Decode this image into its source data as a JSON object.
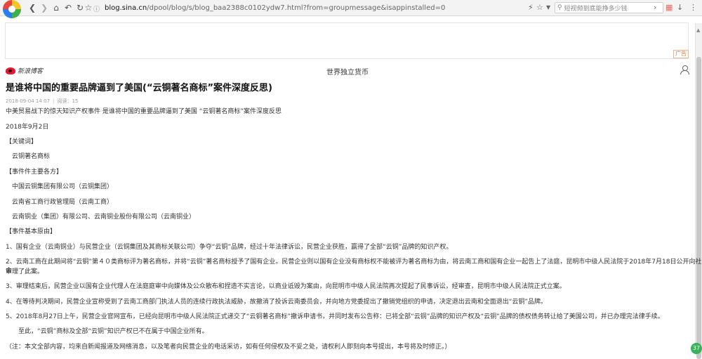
{
  "browser": {
    "url_host": "blog.sina.cn",
    "url_path": "/dpool/blog/s/blog_baa2388c0102ydw7.html?from=groupmessage&isappinstalled=0",
    "search_placeholder": "短视频到底能挣多少钱"
  },
  "ad": {
    "badge": "广告"
  },
  "blog": {
    "logo_text": "新浪博客",
    "blog_name": "世界独立货币"
  },
  "article": {
    "title": "是谁将中国的重要品牌逼到了美国(“云铜著名商标”案件深度反思)",
    "date": "2018-09-04 14:07",
    "reads": "阅读：15",
    "subtitle": "中美贸易战下的惊天知识产权事件 是谁将中国的重要品牌逼到了美国 “云铜著名商标”案件深度反思",
    "pub_date": "2018年9月2日",
    "kw_heading": "【关键词】",
    "kw": "云铜著名商标",
    "parties_heading": "【事件件主要各方】",
    "party1": "中国云铜集团有限公司（云铜集团）",
    "party2": "云南省工商行政管理局（云南工商）",
    "party3": "云南铜业（集团）有限公司、云南铜业股份有限公司（云南铜业）",
    "origin_heading": "【事件基本原由】",
    "item1": "1、国有企业（云南铜业）与民营企业（云铜集团及其商标关联公司）争夺“云铜”品牌，经过十年法律诉讼，民营企业获胜，赢得了全部“云铜”品牌的知识产权。",
    "item2a": "2、云南工商在此期间将“云铜”第４０类商标评为著名商标，并将“云铜”著名商标授予了国有企业。民营企业则以国有企业没有商标权不能被评为著名商标为由，将云南工商和国有企业一起告上了法庭，昆明市中级人民法院于2018年7月18日公开向社会",
    "item2b": "审理了此案。",
    "item3": "3、审理结束后，民营企业以国有企业代理人在法庭庭审中向媒体及公众散布和捏造不实言论，以商业诋毁为案由，向昆明市中级人民法院再次提起了民事诉讼，经审查，昆明市中级人民法院正式立案。",
    "item4": "4、在等待判决期间，民营企业宣称受到了云南工商部门执法人员的连续行政执法威胁，故撤消了投诉云南委员会，并向地方党委提出了撤销党组织的申请，决定退出云南和全面退出“云铜”品牌。",
    "item5": "5、2018年8月27日上午，民营企业官网宣布，已经向昆明市中级人民法院正式递交了“云铜著名商标”撤诉申请书，并同时发布公告称：已将全部“云铜”品牌的知识产权及“云铜”品牌的债权债务转让给了美国公司，并已办理完法律手续。",
    "item6": "至此，“云铜”商标及全部“云铜”知识产权已不在属于中国企业所有。",
    "note": "（注：本文全部内容，均来自新闻报道及网络消息，以及笔者向民营企业的电话采访，如有任何侵权及不妥之处，请权利人即刻向本号提出，本号将及时修正。）"
  },
  "floating_badge": "37"
}
